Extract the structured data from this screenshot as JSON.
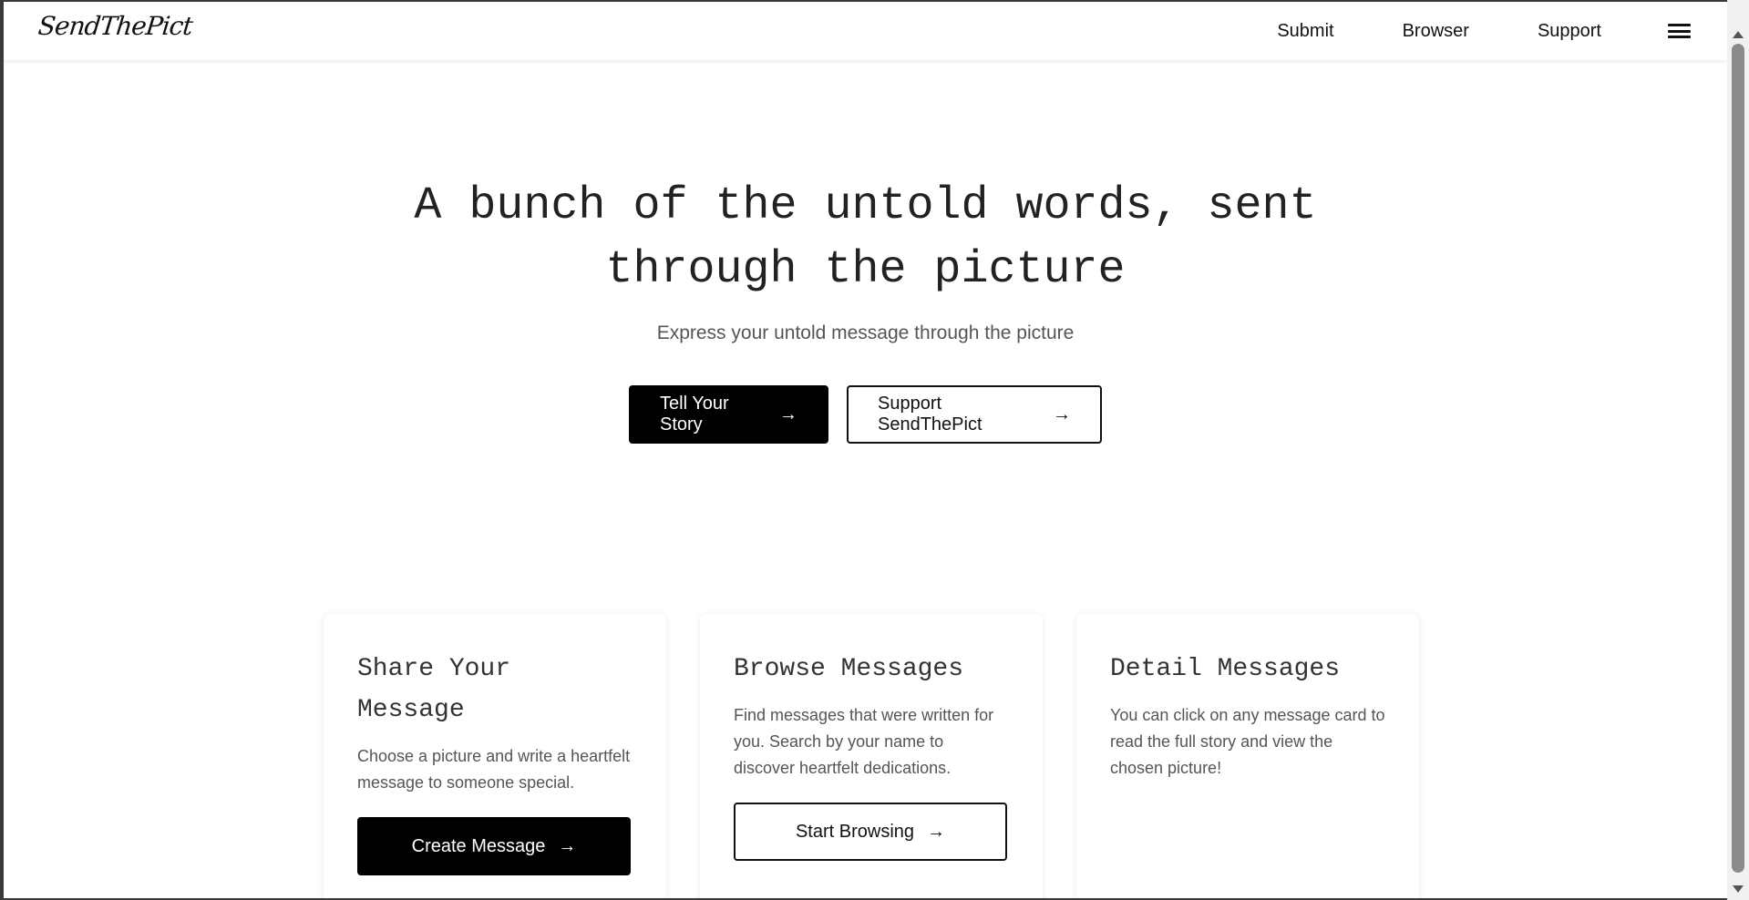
{
  "navbar": {
    "logo": "SendThePict",
    "links": [
      "Submit",
      "Browser",
      "Support"
    ],
    "menu_icon": "hamburger-menu-icon"
  },
  "hero": {
    "title_line1": "A bunch of the untold words, sent",
    "title_line2": "through the picture",
    "subtitle": "Express your untold message through the picture",
    "primary_button": "Tell Your Story",
    "secondary_button": "Support SendThePict",
    "arrow": "→"
  },
  "cards": [
    {
      "title": "Share Your Message",
      "text": "Choose a picture and write a heartfelt message to someone special.",
      "button": "Create Message"
    },
    {
      "title": "Browse Messages",
      "text": "Find messages that were written for you. Search by your name to discover heartfelt dedications.",
      "button": "Start Browsing"
    },
    {
      "title": "Detail Messages",
      "text": "You can click on any message card to read the full story and view the chosen picture!"
    }
  ]
}
